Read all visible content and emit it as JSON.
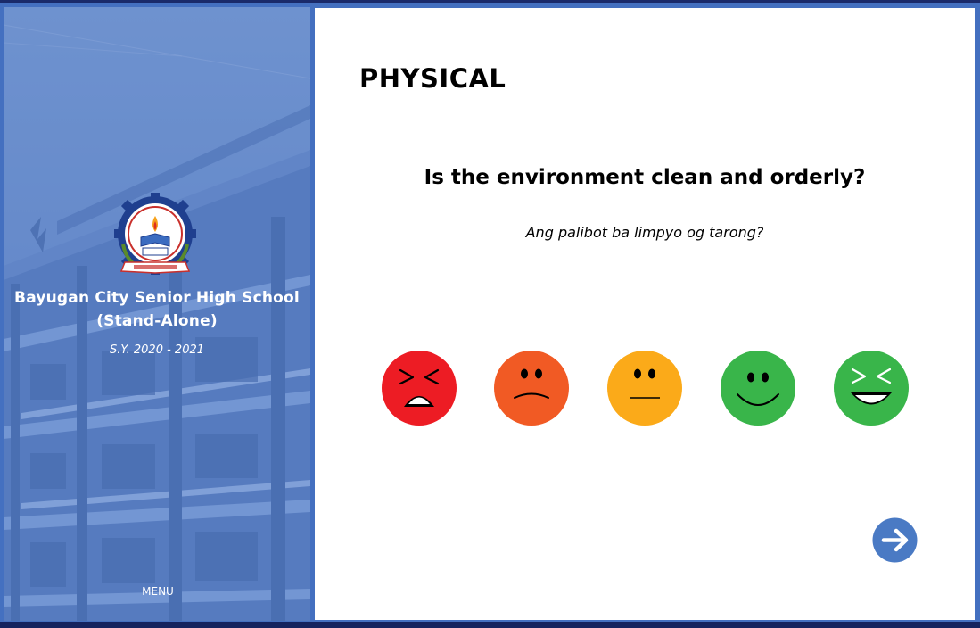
{
  "sidebar": {
    "school_name_line1": "Bayugan City Senior High School",
    "school_name_line2": "(Stand-Alone)",
    "school_year": "S.Y. 2020 - 2021",
    "menu_label": "MENU",
    "logo_icon": "school-seal-logo"
  },
  "main": {
    "section_title": "PHYSICAL",
    "question": "Is the environment clean and orderly?",
    "question_translation": "Ang palibot ba limpyo og tarong?",
    "faces": [
      {
        "name": "very-bad-face-icon",
        "color": "#ed1c24"
      },
      {
        "name": "bad-face-icon",
        "color": "#f15a24"
      },
      {
        "name": "neutral-face-icon",
        "color": "#fbaa19"
      },
      {
        "name": "good-face-icon",
        "color": "#39b54a"
      },
      {
        "name": "very-good-face-icon",
        "color": "#39b54a"
      }
    ],
    "next_icon": "arrow-right-icon"
  },
  "colors": {
    "frame": "#4470c0",
    "sidebar_tint": "#5b7fbf",
    "next_button": "#4a7ac4"
  }
}
